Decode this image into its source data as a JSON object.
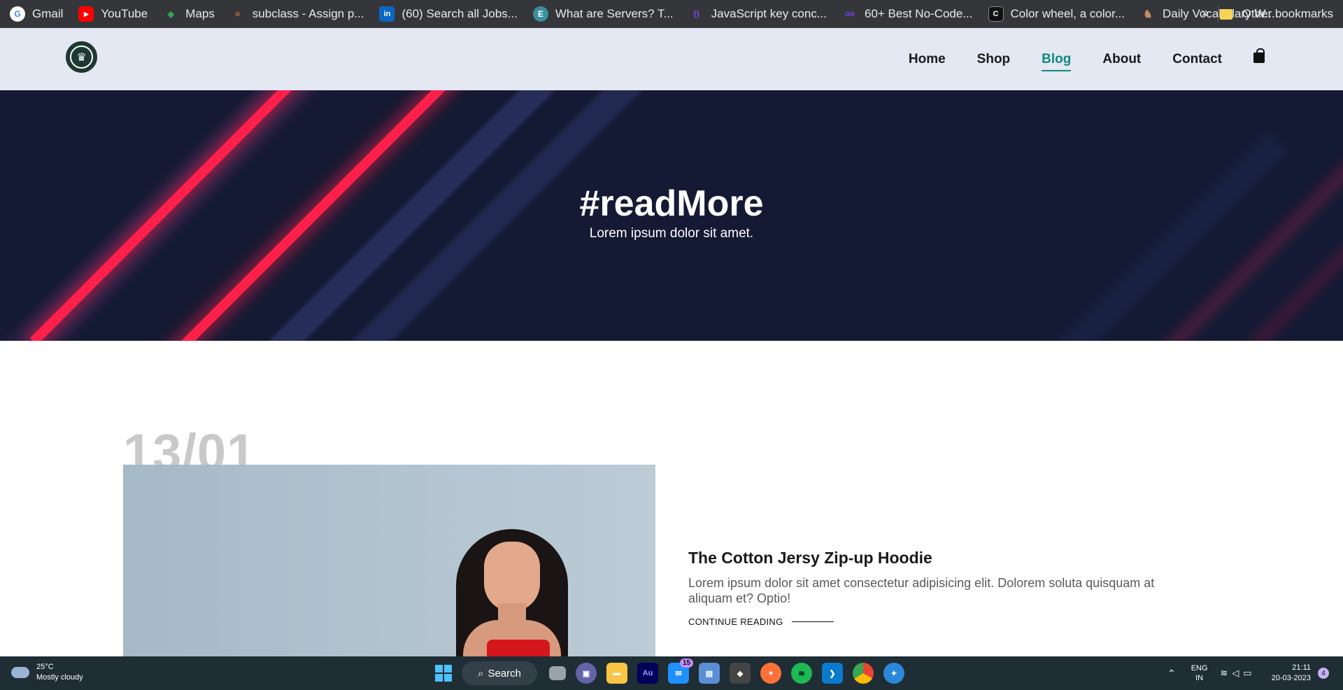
{
  "bookmarks": [
    {
      "label": "Gmail",
      "icon": "google-icon",
      "color": "#4285f4",
      "glyph": "G"
    },
    {
      "label": "YouTube",
      "icon": "youtube-icon",
      "color": "#ff0000",
      "glyph": "▶"
    },
    {
      "label": "Maps",
      "icon": "maps-icon",
      "color": "#34a853",
      "glyph": "◆"
    },
    {
      "label": "subclass - Assign p...",
      "icon": "stackoverflow-icon",
      "color": "#f48024",
      "glyph": "≡"
    },
    {
      "label": "(60) Search all Jobs...",
      "icon": "linkedin-icon",
      "color": "#0a66c2",
      "glyph": "in"
    },
    {
      "label": "What are Servers? T...",
      "icon": "site-icon",
      "color": "#3b8f9e",
      "glyph": "E"
    },
    {
      "label": "JavaScript key conc...",
      "icon": "js-icon",
      "color": "#5b2bd0",
      "glyph": "{}"
    },
    {
      "label": "60+ Best No-Code...",
      "icon": "nocode-icon",
      "color": "#7b3ff2",
      "glyph": "oo"
    },
    {
      "label": "Color wheel, a color...",
      "icon": "canva-icon",
      "color": "#111111",
      "glyph": "C"
    },
    {
      "label": "Daily Vocabulary W...",
      "icon": "cow-icon",
      "color": "#9c5a3c",
      "glyph": "♞"
    }
  ],
  "bookmarks_more": "»",
  "other_bookmarks": "Other bookmarks",
  "nav": {
    "links": [
      "Home",
      "Shop",
      "Blog",
      "About",
      "Contact"
    ],
    "active": "Blog"
  },
  "hero": {
    "title": "#readMore",
    "subtitle": "Lorem ipsum dolor sit amet."
  },
  "post": {
    "date": "13/01",
    "title": "The Cotton Jersy Zip-up Hoodie",
    "text": "Lorem ipsum dolor sit amet consectetur adipisicing elit. Dolorem soluta quisquam at aliquam et? Optio!",
    "read_more": "CONTINUE READING"
  },
  "taskbar": {
    "temp": "25°C",
    "weather": "Mostly cloudy",
    "search_label": "Search",
    "mail_badge": "15",
    "lang_line1": "ENG",
    "lang_line2": "IN",
    "time": "21:11",
    "date": "20-03-2023",
    "notifications": "4"
  },
  "colors": {
    "accent": "#0f8a7e",
    "hero_bg": "#141a33",
    "stripe_red": "#ff1f4b"
  }
}
